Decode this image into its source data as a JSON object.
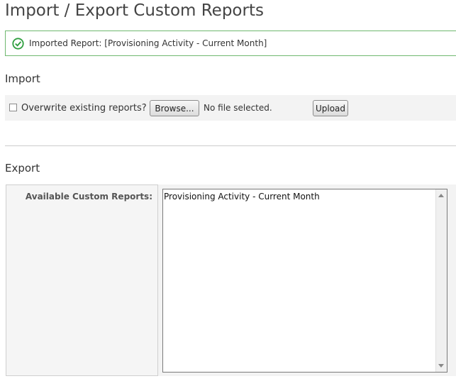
{
  "page": {
    "title": "Import / Export Custom Reports"
  },
  "notice": {
    "icon": "check-circle-icon",
    "message": "Imported Report: [Provisioning Activity - Current Month]",
    "color": "#6fb86f"
  },
  "import": {
    "heading": "Import",
    "overwrite_label": "Overwrite existing reports?",
    "overwrite_checked": false,
    "browse_label": "Browse...",
    "file_status": "No file selected.",
    "upload_label": "Upload"
  },
  "export": {
    "heading": "Export",
    "reports_label": "Available Custom Reports:",
    "reports": [
      "Provisioning Activity - Current Month"
    ]
  }
}
